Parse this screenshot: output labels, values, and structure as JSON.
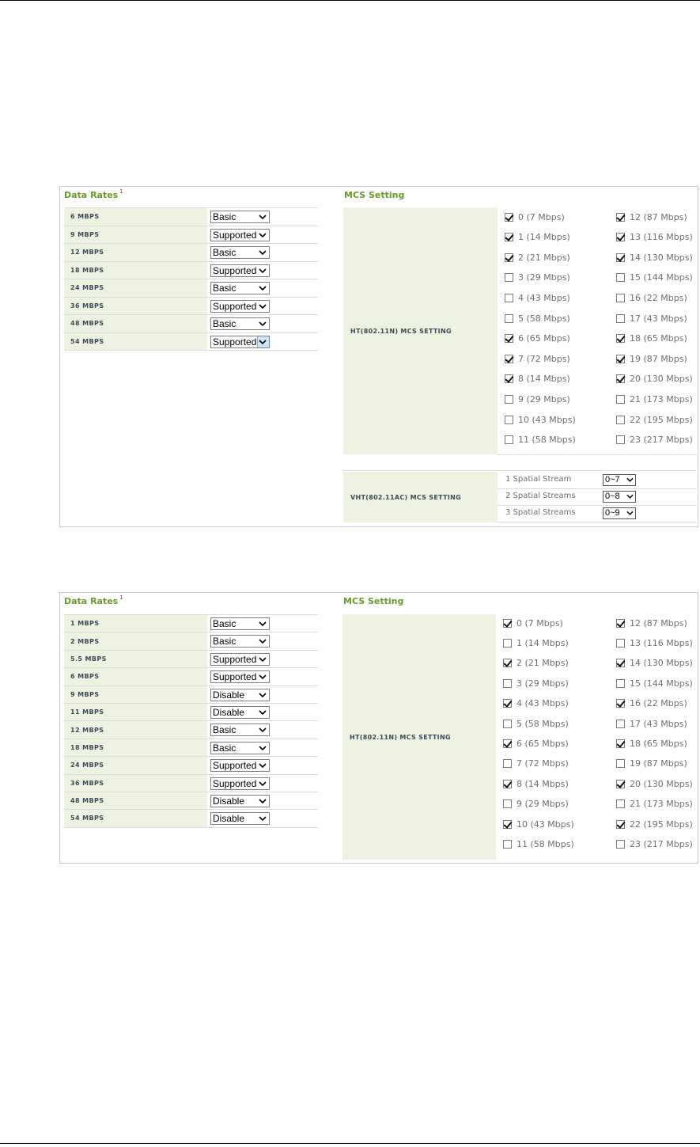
{
  "panel1": {
    "data_rates_title": "Data Rates",
    "footnote": "1",
    "mcs_title": "MCS Setting",
    "rates": [
      {
        "label": "6 MBPS",
        "value": "Basic"
      },
      {
        "label": "9 MBPS",
        "value": "Supported"
      },
      {
        "label": "12 MBPS",
        "value": "Basic"
      },
      {
        "label": "18 MBPS",
        "value": "Supported"
      },
      {
        "label": "24 MBPS",
        "value": "Basic"
      },
      {
        "label": "36 MBPS",
        "value": "Supported"
      },
      {
        "label": "48 MBPS",
        "value": "Basic"
      },
      {
        "label": "54 MBPS",
        "value": "Supported"
      }
    ],
    "ht_label": "HT(802.11N) MCS SETTING",
    "ht_items": [
      {
        "text": "0 (7 Mbps)",
        "checked": true
      },
      {
        "text": "1 (14 Mbps)",
        "checked": true
      },
      {
        "text": "2 (21 Mbps)",
        "checked": true
      },
      {
        "text": "3 (29 Mbps)",
        "checked": false
      },
      {
        "text": "4 (43 Mbps)",
        "checked": false
      },
      {
        "text": "5 (58 Mbps)",
        "checked": false
      },
      {
        "text": "6 (65 Mbps)",
        "checked": true
      },
      {
        "text": "7 (72 Mbps)",
        "checked": true
      },
      {
        "text": "8 (14 Mbps)",
        "checked": true
      },
      {
        "text": "9 (29 Mbps)",
        "checked": false
      },
      {
        "text": "10 (43 Mbps)",
        "checked": false
      },
      {
        "text": "11 (58 Mbps)",
        "checked": false
      },
      {
        "text": "12 (87 Mbps)",
        "checked": true
      },
      {
        "text": "13 (116 Mbps)",
        "checked": true
      },
      {
        "text": "14 (130 Mbps)",
        "checked": true
      },
      {
        "text": "15 (144 Mbps)",
        "checked": false
      },
      {
        "text": "16 (22 Mbps)",
        "checked": false
      },
      {
        "text": "17 (43 Mbps)",
        "checked": false
      },
      {
        "text": "18 (65 Mbps)",
        "checked": true
      },
      {
        "text": "19 (87 Mbps)",
        "checked": true
      },
      {
        "text": "20 (130 Mbps)",
        "checked": true
      },
      {
        "text": "21 (173 Mbps)",
        "checked": false
      },
      {
        "text": "22 (195 Mbps)",
        "checked": false
      },
      {
        "text": "23 (217 Mbps)",
        "checked": false
      }
    ],
    "vht_label": "VHT(802.11AC) MCS SETTING",
    "vht_rows": [
      {
        "label": "1 Spatial Stream",
        "value": "0~7"
      },
      {
        "label": "2 Spatial Streams",
        "value": "0~8"
      },
      {
        "label": "3 Spatial Streams",
        "value": "0~9"
      }
    ]
  },
  "panel2": {
    "data_rates_title": "Data Rates",
    "footnote": "1",
    "mcs_title": "MCS Setting",
    "rates": [
      {
        "label": "1 MBPS",
        "value": "Basic"
      },
      {
        "label": "2 MBPS",
        "value": "Basic"
      },
      {
        "label": "5.5 MBPS",
        "value": "Supported"
      },
      {
        "label": "6 MBPS",
        "value": "Supported"
      },
      {
        "label": "9 MBPS",
        "value": "Disable"
      },
      {
        "label": "11 MBPS",
        "value": "Disable"
      },
      {
        "label": "12 MBPS",
        "value": "Basic"
      },
      {
        "label": "18 MBPS",
        "value": "Basic"
      },
      {
        "label": "24 MBPS",
        "value": "Supported"
      },
      {
        "label": "36 MBPS",
        "value": "Supported"
      },
      {
        "label": "48 MBPS",
        "value": "Disable"
      },
      {
        "label": "54 MBPS",
        "value": "Disable"
      }
    ],
    "ht_label": "HT(802.11N) MCS SETTING",
    "ht_items": [
      {
        "text": "0 (7 Mbps)",
        "checked": true
      },
      {
        "text": "1 (14 Mbps)",
        "checked": false
      },
      {
        "text": "2 (21 Mbps)",
        "checked": true
      },
      {
        "text": "3 (29 Mbps)",
        "checked": false
      },
      {
        "text": "4 (43 Mbps)",
        "checked": true
      },
      {
        "text": "5 (58 Mbps)",
        "checked": false
      },
      {
        "text": "6 (65 Mbps)",
        "checked": true
      },
      {
        "text": "7 (72 Mbps)",
        "checked": false
      },
      {
        "text": "8 (14 Mbps)",
        "checked": true
      },
      {
        "text": "9 (29 Mbps)",
        "checked": false
      },
      {
        "text": "10 (43 Mbps)",
        "checked": true
      },
      {
        "text": "11 (58 Mbps)",
        "checked": false
      },
      {
        "text": "12 (87 Mbps)",
        "checked": true
      },
      {
        "text": "13 (116 Mbps)",
        "checked": false
      },
      {
        "text": "14 (130 Mbps)",
        "checked": true
      },
      {
        "text": "15 (144 Mbps)",
        "checked": false
      },
      {
        "text": "16 (22 Mbps)",
        "checked": true
      },
      {
        "text": "17 (43 Mbps)",
        "checked": false
      },
      {
        "text": "18 (65 Mbps)",
        "checked": true
      },
      {
        "text": "19 (87 Mbps)",
        "checked": false
      },
      {
        "text": "20 (130 Mbps)",
        "checked": true
      },
      {
        "text": "21 (173 Mbps)",
        "checked": false
      },
      {
        "text": "22 (195 Mbps)",
        "checked": true
      },
      {
        "text": "23 (217 Mbps)",
        "checked": false
      }
    ]
  }
}
